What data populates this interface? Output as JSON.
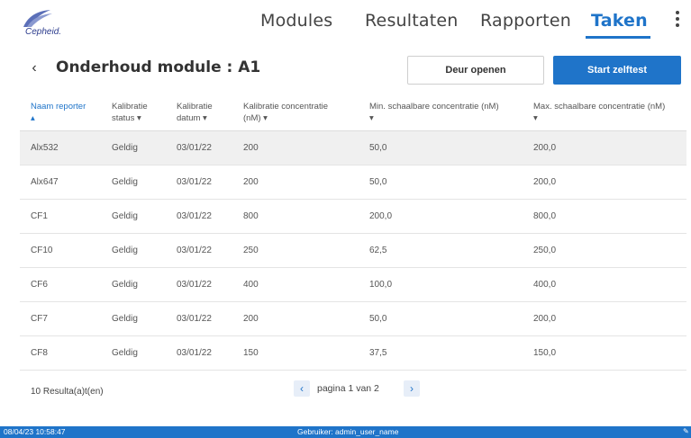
{
  "app": {
    "logo_text": "Cepheid."
  },
  "nav": {
    "modules": "Modules",
    "resultaten": "Resultaten",
    "rapporten": "Rapporten",
    "taken": "Taken"
  },
  "header": {
    "title": "Onderhoud module : A1",
    "back_glyph": "‹",
    "door_button": "Deur openen",
    "start_button": "Start zelftest"
  },
  "table": {
    "columns": [
      {
        "line1": "Naam reporter",
        "line2": "▴"
      },
      {
        "line1": "Kalibratie",
        "line2": "status ▾"
      },
      {
        "line1": "Kalibratie",
        "line2": "datum ▾"
      },
      {
        "line1": "Kalibratie concentratie",
        "line2": "(nM) ▾"
      },
      {
        "line1": "Min. schaalbare concentratie (nM)",
        "line2": "▾"
      },
      {
        "line1": "Max. schaalbare concentratie (nM)",
        "line2": "▾"
      }
    ],
    "rows": [
      [
        "Alx532",
        "Geldig",
        "03/01/22",
        "200",
        "50,0",
        "200,0"
      ],
      [
        "Alx647",
        "Geldig",
        "03/01/22",
        "200",
        "50,0",
        "200,0"
      ],
      [
        "CF1",
        "Geldig",
        "03/01/22",
        "800",
        "200,0",
        "800,0"
      ],
      [
        "CF10",
        "Geldig",
        "03/01/22",
        "250",
        "62,5",
        "250,0"
      ],
      [
        "CF6",
        "Geldig",
        "03/01/22",
        "400",
        "100,0",
        "400,0"
      ],
      [
        "CF7",
        "Geldig",
        "03/01/22",
        "200",
        "50,0",
        "200,0"
      ],
      [
        "CF8",
        "Geldig",
        "03/01/22",
        "150",
        "37,5",
        "150,0"
      ]
    ]
  },
  "footer": {
    "results_count": "10 Resulta(a)t(en)",
    "page_label": "pagina 1 van 2",
    "prev_glyph": "‹",
    "next_glyph": "›"
  },
  "statusbar": {
    "datetime": "08/04/23 10:58:47",
    "user": "Gebruiker: admin_user_name",
    "icon_glyph": "✎"
  },
  "colors": {
    "accent": "#1f74c9",
    "selected_row": "#f0f0f0"
  }
}
